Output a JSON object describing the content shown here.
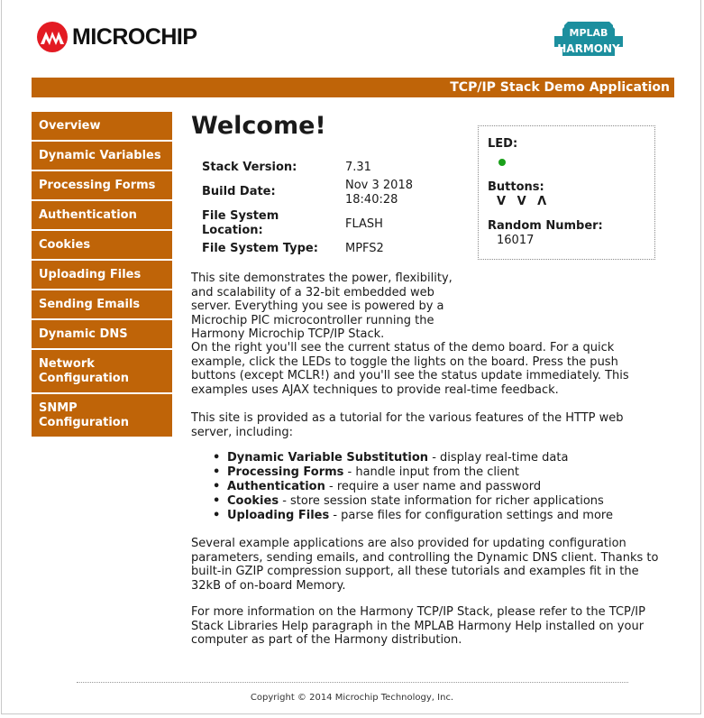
{
  "header": {
    "brand": "MICROCHIP",
    "harmony_logo_top": "MPLAB",
    "harmony_logo_bottom": "HARMONY",
    "banner_title": "TCP/IP Stack Demo Application",
    "brand_color": "#bf6408"
  },
  "sidebar": {
    "items": [
      {
        "label": "Overview"
      },
      {
        "label": "Dynamic Variables"
      },
      {
        "label": "Processing Forms"
      },
      {
        "label": "Authentication"
      },
      {
        "label": "Cookies"
      },
      {
        "label": "Uploading Files"
      },
      {
        "label": "Sending Emails"
      },
      {
        "label": "Dynamic DNS"
      },
      {
        "label": "Network Configuration"
      },
      {
        "label": "SNMP Configuration"
      }
    ]
  },
  "main": {
    "heading": "Welcome!",
    "info": [
      {
        "label": "Stack Version:",
        "value": "7.31"
      },
      {
        "label": "Build Date:",
        "value": "Nov 3 2018 18:40:28"
      },
      {
        "label": "File System Location:",
        "value": "FLASH"
      },
      {
        "label": "File System Type:",
        "value": "MPFS2"
      }
    ],
    "para1": "This site demonstrates the power, flexibility, and scalability of a 32-bit embedded web server. Everything you see is powered by a Microchip PIC microcontroller running the Harmony Microchip TCP/IP Stack.",
    "para2": "On the right you'll see the current status of the demo board. For a quick example, click the LEDs to toggle the lights on the board. Press the push buttons (except MCLR!) and you'll see the status update immediately. This examples uses AJAX techniques to provide real-time feedback.",
    "para3": "This site is provided as a tutorial for the various features of the HTTP web server, including:",
    "features": [
      {
        "name": "Dynamic Variable Substitution",
        "desc": " - display real-time data"
      },
      {
        "name": "Processing Forms",
        "desc": " - handle input from the client"
      },
      {
        "name": "Authentication",
        "desc": " - require a user name and password"
      },
      {
        "name": "Cookies",
        "desc": " - store session state information for richer applications"
      },
      {
        "name": "Uploading Files",
        "desc": " - parse files for configuration settings and more"
      }
    ],
    "para4": "Several example applications are also provided for updating configuration parameters, sending emails, and controlling the Dynamic DNS client. Thanks to built-in GZIP compression support, all these tutorials and examples fit in the 32kB of on-board Memory.",
    "para5": "For more information on the Harmony TCP/IP Stack, please refer to the TCP/IP Stack Libraries Help paragraph in the MPLAB Harmony Help installed on your computer as part of the Harmony distribution."
  },
  "status": {
    "led_label": "LED:",
    "led_color": "#1aa01a",
    "buttons_label": "Buttons:",
    "buttons_value": "V V Λ",
    "random_label": "Random Number:",
    "random_value": "16017"
  },
  "footer": {
    "copyright": "Copyright © 2014 Microchip Technology, Inc."
  }
}
